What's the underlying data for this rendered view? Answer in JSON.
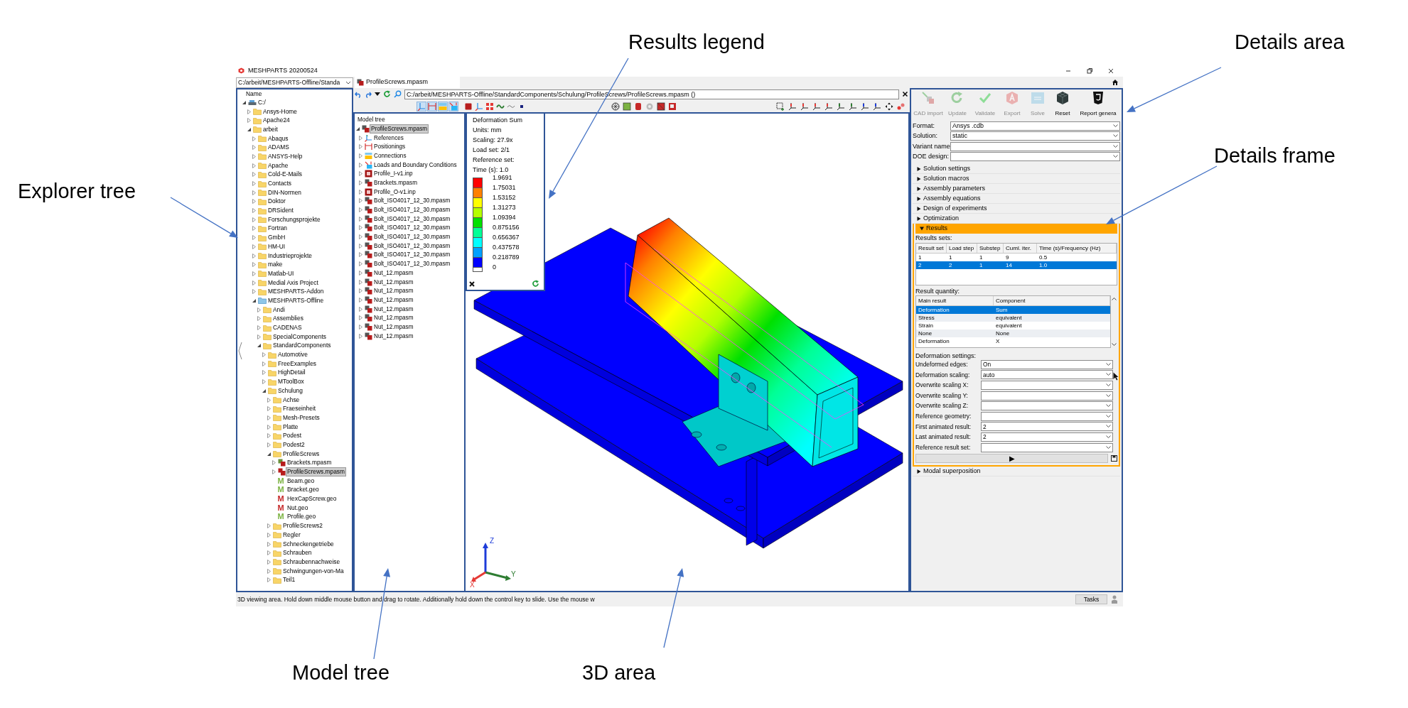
{
  "callouts": [
    {
      "label": "Explorer tree"
    },
    {
      "label": "Results legend"
    },
    {
      "label": "Details area"
    },
    {
      "label": "Details frame"
    },
    {
      "label": "Model tree"
    },
    {
      "label": "3D area"
    }
  ],
  "window": {
    "title": "MESHPARTS 20200524"
  },
  "explorer": {
    "path": "C:/arbeit/MESHPARTS-Offline/Standa",
    "header": "Name",
    "tree": [
      {
        "label": "C:/",
        "kind": "drive",
        "expanded": true,
        "selected": false,
        "children": [
          {
            "label": "Ansys-Home",
            "kind": "folder",
            "expanded": false,
            "selected": false
          },
          {
            "label": "Apache24",
            "kind": "folder",
            "expanded": false,
            "selected": false
          },
          {
            "label": "arbeit",
            "kind": "folder",
            "expanded": true,
            "selected": false,
            "children": [
              {
                "label": "Abaqus",
                "kind": "folder",
                "expanded": false,
                "selected": false
              },
              {
                "label": "ADAMS",
                "kind": "folder",
                "expanded": false,
                "selected": false
              },
              {
                "label": "ANSYS-Help",
                "kind": "folder",
                "expanded": false,
                "selected": false
              },
              {
                "label": "Apache",
                "kind": "folder",
                "expanded": false,
                "selected": false
              },
              {
                "label": "Cold-E-Mails",
                "kind": "folder",
                "expanded": false,
                "selected": false
              },
              {
                "label": "Contacts",
                "kind": "folder",
                "expanded": false,
                "selected": false
              },
              {
                "label": "DIN-Normen",
                "kind": "folder",
                "expanded": false,
                "selected": false
              },
              {
                "label": "Doktor",
                "kind": "folder",
                "expanded": false,
                "selected": false
              },
              {
                "label": "DRSident",
                "kind": "folder",
                "expanded": false,
                "selected": false
              },
              {
                "label": "Forschungsprojekte",
                "kind": "folder",
                "expanded": false,
                "selected": false
              },
              {
                "label": "Fortran",
                "kind": "folder",
                "expanded": false,
                "selected": false
              },
              {
                "label": "GmbH",
                "kind": "folder",
                "expanded": false,
                "selected": false
              },
              {
                "label": "HM-UI",
                "kind": "folder",
                "expanded": false,
                "selected": false
              },
              {
                "label": "Industrieprojekte",
                "kind": "folder",
                "expanded": false,
                "selected": false
              },
              {
                "label": "make",
                "kind": "folder",
                "expanded": false,
                "selected": false
              },
              {
                "label": "Matlab-UI",
                "kind": "folder",
                "expanded": false,
                "selected": false
              },
              {
                "label": "Medial Axis Project",
                "kind": "folder",
                "expanded": false,
                "selected": false
              },
              {
                "label": "MESHPARTS-Addon",
                "kind": "folder",
                "expanded": false,
                "selected": false
              },
              {
                "label": "MESHPARTS-Offline",
                "kind": "project",
                "expanded": true,
                "selected": false,
                "children": [
                  {
                    "label": "Andi",
                    "kind": "folder",
                    "expanded": false,
                    "selected": false
                  },
                  {
                    "label": "Assemblies",
                    "kind": "folder",
                    "expanded": false,
                    "selected": false
                  },
                  {
                    "label": "CADENAS",
                    "kind": "folder",
                    "expanded": false,
                    "selected": false
                  },
                  {
                    "label": "SpecialComponents",
                    "kind": "folder",
                    "expanded": false,
                    "selected": false
                  },
                  {
                    "label": "StandardComponents",
                    "kind": "folder",
                    "expanded": true,
                    "selected": false,
                    "children": [
                      {
                        "label": "Automotive",
                        "kind": "folder",
                        "expanded": false,
                        "selected": false
                      },
                      {
                        "label": "FreeExamples",
                        "kind": "folder",
                        "expanded": false,
                        "selected": false
                      },
                      {
                        "label": "HighDetail",
                        "kind": "folder",
                        "expanded": false,
                        "selected": false
                      },
                      {
                        "label": "MToolBox",
                        "kind": "folder",
                        "expanded": false,
                        "selected": false
                      },
                      {
                        "label": "Schulung",
                        "kind": "folder",
                        "expanded": true,
                        "selected": false,
                        "children": [
                          {
                            "label": "Achse",
                            "kind": "folder",
                            "expanded": false,
                            "selected": false
                          },
                          {
                            "label": "Fraeseinheit",
                            "kind": "folder",
                            "expanded": false,
                            "selected": false
                          },
                          {
                            "label": "Mesh-Presets",
                            "kind": "folder",
                            "expanded": false,
                            "selected": false
                          },
                          {
                            "label": "Platte",
                            "kind": "folder",
                            "expanded": false,
                            "selected": false
                          },
                          {
                            "label": "Podest",
                            "kind": "folder",
                            "expanded": false,
                            "selected": false
                          },
                          {
                            "label": "Podest2",
                            "kind": "folder",
                            "expanded": false,
                            "selected": false
                          },
                          {
                            "label": "ProfileScrews",
                            "kind": "folder",
                            "expanded": true,
                            "selected": false,
                            "children": [
                              {
                                "label": "Brackets.mpasm",
                                "kind": "assembly",
                                "color": "#6a8f3a",
                                "expanded": false,
                                "selected": false
                              },
                              {
                                "label": "ProfileScrews.mpasm",
                                "kind": "assembly",
                                "color": "#b71c1c",
                                "expanded": false,
                                "selected": true
                              },
                              {
                                "label": "Beam.geo",
                                "kind": "geo",
                                "badge": "M",
                                "color": "#7cb342",
                                "selected": false
                              },
                              {
                                "label": "Bracket.geo",
                                "kind": "geo",
                                "badge": "M",
                                "color": "#7cb342",
                                "selected": false
                              },
                              {
                                "label": "HexCapScrew.geo",
                                "kind": "geo",
                                "badge": "M",
                                "color": "#c62828",
                                "selected": false
                              },
                              {
                                "label": "Nut.geo",
                                "kind": "geo",
                                "badge": "M",
                                "color": "#c62828",
                                "selected": false
                              },
                              {
                                "label": "Profile.geo",
                                "kind": "geo",
                                "badge": "M",
                                "color": "#7cb342",
                                "selected": false
                              }
                            ]
                          },
                          {
                            "label": "ProfileScrews2",
                            "kind": "folder",
                            "expanded": false,
                            "selected": false
                          },
                          {
                            "label": "Regler",
                            "kind": "folder",
                            "expanded": false,
                            "selected": false
                          },
                          {
                            "label": "Schneckengetriebe",
                            "kind": "folder",
                            "expanded": false,
                            "selected": false
                          },
                          {
                            "label": "Schrauben",
                            "kind": "folder",
                            "expanded": false,
                            "selected": false
                          },
                          {
                            "label": "Schraubennachweise",
                            "kind": "folder",
                            "expanded": false,
                            "selected": false
                          },
                          {
                            "label": "Schwingungen-von-Ma",
                            "kind": "folder",
                            "expanded": false,
                            "selected": false
                          },
                          {
                            "label": "Teil1",
                            "kind": "folder",
                            "expanded": false,
                            "selected": false
                          }
                        ]
                      }
                    ]
                  }
                ]
              }
            ]
          }
        ]
      }
    ]
  },
  "document_tab": {
    "label": "ProfileScrews.mpasm",
    "selected": true
  },
  "toolbar": {
    "path": "C:/arbeit/MESHPARTS-Offline/StandardComponents/Schulung/ProfileScrews/ProfileScrews.mpasm ()"
  },
  "model_tree": {
    "header": "Model tree",
    "root": {
      "label": "ProfileScrews.mpasm",
      "kind": "assembly",
      "expanded": true,
      "selected": true,
      "children": [
        {
          "label": "References",
          "kind": "references",
          "expanded": false,
          "selected": false
        },
        {
          "label": "Positionings",
          "kind": "positionings",
          "expanded": false,
          "selected": false
        },
        {
          "label": "Connections",
          "kind": "connections",
          "expanded": false,
          "selected": false
        },
        {
          "label": "Loads and Boundary Conditions",
          "kind": "loads",
          "expanded": false,
          "selected": false
        },
        {
          "label": "Profile_I-v1.inp",
          "kind": "inp",
          "expanded": false,
          "selected": false
        },
        {
          "label": "Brackets.mpasm",
          "kind": "assembly",
          "expanded": false,
          "selected": false
        },
        {
          "label": "Profile_O-v1.inp",
          "kind": "inp",
          "expanded": false,
          "selected": false
        },
        {
          "label": "Bolt_ISO4017_12_30.mpasm",
          "kind": "assembly",
          "expanded": false,
          "selected": false
        },
        {
          "label": "Bolt_ISO4017_12_30.mpasm",
          "kind": "assembly",
          "expanded": false,
          "selected": false
        },
        {
          "label": "Bolt_ISO4017_12_30.mpasm",
          "kind": "assembly",
          "expanded": false,
          "selected": false
        },
        {
          "label": "Bolt_ISO4017_12_30.mpasm",
          "kind": "assembly",
          "expanded": false,
          "selected": false
        },
        {
          "label": "Bolt_ISO4017_12_30.mpasm",
          "kind": "assembly",
          "expanded": false,
          "selected": false
        },
        {
          "label": "Bolt_ISO4017_12_30.mpasm",
          "kind": "assembly",
          "expanded": false,
          "selected": false
        },
        {
          "label": "Bolt_ISO4017_12_30.mpasm",
          "kind": "assembly",
          "expanded": false,
          "selected": false
        },
        {
          "label": "Bolt_ISO4017_12_30.mpasm",
          "kind": "assembly",
          "expanded": false,
          "selected": false
        },
        {
          "label": "Nut_12.mpasm",
          "kind": "assembly",
          "expanded": false,
          "selected": false
        },
        {
          "label": "Nut_12.mpasm",
          "kind": "assembly",
          "expanded": false,
          "selected": false
        },
        {
          "label": "Nut_12.mpasm",
          "kind": "assembly",
          "expanded": false,
          "selected": false
        },
        {
          "label": "Nut_12.mpasm",
          "kind": "assembly",
          "expanded": false,
          "selected": false
        },
        {
          "label": "Nut_12.mpasm",
          "kind": "assembly",
          "expanded": false,
          "selected": false
        },
        {
          "label": "Nut_12.mpasm",
          "kind": "assembly",
          "expanded": false,
          "selected": false
        },
        {
          "label": "Nut_12.mpasm",
          "kind": "assembly",
          "expanded": false,
          "selected": false
        },
        {
          "label": "Nut_12.mpasm",
          "kind": "assembly",
          "expanded": false,
          "selected": false
        }
      ]
    }
  },
  "legend": {
    "title": "Deformation Sum",
    "lines": [
      "Units: mm",
      "Scaling: 27.9x",
      "Load set: 2/1",
      "Reference set:",
      "Time (s): 1.0"
    ],
    "bands": [
      {
        "color": "#ff0000"
      },
      {
        "color": "#ff8000"
      },
      {
        "color": "#ffff00"
      },
      {
        "color": "#b4ff00"
      },
      {
        "color": "#00e000"
      },
      {
        "color": "#00ff96"
      },
      {
        "color": "#00ffff"
      },
      {
        "color": "#00a0ff"
      },
      {
        "color": "#0000ff"
      }
    ],
    "values": [
      "1.9691",
      "1.75031",
      "1.53152",
      "1.31273",
      "1.09394",
      "0.875156",
      "0.656367",
      "0.437578",
      "0.218789",
      "0"
    ]
  },
  "axis_labels": [
    "Z",
    "Y",
    "X"
  ],
  "details": {
    "buttons": [
      {
        "label": "CAD import",
        "kind": "cad",
        "disabled": true
      },
      {
        "label": "Update",
        "kind": "update",
        "disabled": true
      },
      {
        "label": "Validate",
        "kind": "validate",
        "disabled": true
      },
      {
        "label": "Export",
        "kind": "export",
        "disabled": true
      },
      {
        "label": "Solve",
        "kind": "solve",
        "disabled": true
      },
      {
        "label": "Reset",
        "kind": "reset",
        "disabled": false
      },
      {
        "label": "Report genera",
        "kind": "report",
        "disabled": false
      }
    ],
    "fields": [
      {
        "label": "Format:",
        "value": "Ansys .cdb"
      },
      {
        "label": "Solution:",
        "value": "static"
      },
      {
        "label": "Variant name:"
      },
      {
        "label": "DOE design:"
      }
    ],
    "sections": [
      {
        "label": "Solution settings",
        "expanded": false
      },
      {
        "label": "Solution macros",
        "expanded": false
      },
      {
        "label": "Assembly parameters",
        "expanded": false
      },
      {
        "label": "Assembly equations",
        "expanded": false
      },
      {
        "label": "Design of experiments",
        "expanded": false
      },
      {
        "label": "Optimization",
        "expanded": false
      },
      {
        "label": "Results",
        "expanded": true,
        "kind": "results"
      },
      {
        "label": "Modal superposition",
        "expanded": false
      }
    ],
    "results": {
      "sets_label": "Results sets:",
      "sets_columns": [
        "Result set",
        "Load step",
        "Substep",
        "Cuml. iter.",
        "Time (s)/Frequency (Hz)"
      ],
      "sets_rows": [
        {
          "cells": [
            "1",
            "1",
            "1",
            "9",
            "0.5"
          ],
          "selected": false
        },
        {
          "cells": [
            "2",
            "2",
            "1",
            "14",
            "1.0"
          ],
          "selected": true
        }
      ],
      "quantity_label": "Result quantity:",
      "quantity_columns": [
        "Main result",
        "Component"
      ],
      "quantity_rows": [
        {
          "cells": [
            "Deformation",
            "Sum"
          ],
          "selected": true
        },
        {
          "cells": [
            "Stress",
            "equivalent"
          ],
          "selected": false
        },
        {
          "cells": [
            "Strain",
            "equivalent"
          ],
          "selected": false
        },
        {
          "cells": [
            "None",
            "None"
          ],
          "selected": false
        },
        {
          "cells": [
            "Deformation",
            "X"
          ],
          "selected": false
        }
      ],
      "deformation_label": "Deformation settings:",
      "deformation_fields": [
        {
          "label": "Undeformed edges:",
          "value": "On"
        },
        {
          "label": "Deformation scaling:",
          "value": "auto"
        },
        {
          "label": "Overwrite scaling X:"
        },
        {
          "label": "Overwrite scaling Y:"
        },
        {
          "label": "Overwrite scaling Z:"
        },
        {
          "label": "Reference geometry:"
        },
        {
          "label": "First animated result:",
          "value": "2"
        },
        {
          "label": "Last animated result:",
          "value": "2"
        },
        {
          "label": "Reference result set:"
        }
      ],
      "play": "▶"
    }
  },
  "status_bar": {
    "text": "3D viewing area. Hold down middle mouse button and drag to rotate. Additionally hold down the control key to slide. Use the mouse w",
    "tasks": "Tasks"
  }
}
